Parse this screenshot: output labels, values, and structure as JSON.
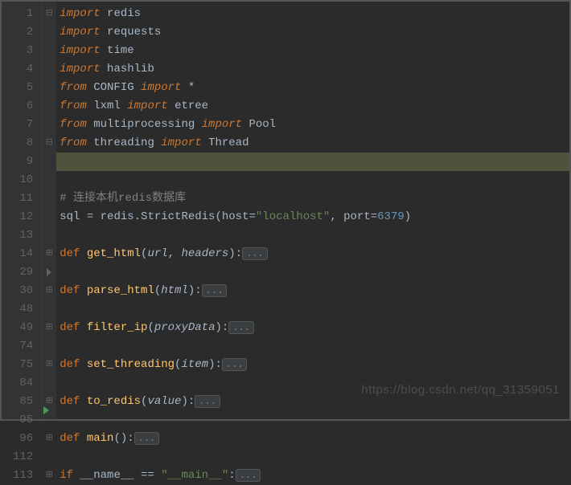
{
  "lines": [
    {
      "num": "1",
      "fold": "⊟",
      "tokens": [
        [
          "kw",
          "import"
        ],
        [
          "ident",
          " redis"
        ]
      ]
    },
    {
      "num": "2",
      "fold": "",
      "tokens": [
        [
          "kw",
          "import"
        ],
        [
          "ident",
          " requests"
        ]
      ]
    },
    {
      "num": "3",
      "fold": "",
      "tokens": [
        [
          "kw",
          "import"
        ],
        [
          "ident",
          " time"
        ]
      ]
    },
    {
      "num": "4",
      "fold": "",
      "tokens": [
        [
          "kw",
          "import"
        ],
        [
          "ident",
          " hashlib"
        ]
      ]
    },
    {
      "num": "5",
      "fold": "",
      "tokens": [
        [
          "kw",
          "from"
        ],
        [
          "ident",
          " CONFIG "
        ],
        [
          "kw",
          "import"
        ],
        [
          "ident",
          " *"
        ]
      ]
    },
    {
      "num": "6",
      "fold": "",
      "tokens": [
        [
          "kw",
          "from"
        ],
        [
          "ident",
          " lxml "
        ],
        [
          "kw",
          "import"
        ],
        [
          "ident",
          " etree"
        ]
      ]
    },
    {
      "num": "7",
      "fold": "",
      "tokens": [
        [
          "kw",
          "from"
        ],
        [
          "ident",
          " multiprocessing "
        ],
        [
          "kw",
          "import"
        ],
        [
          "ident",
          " Pool"
        ]
      ]
    },
    {
      "num": "8",
      "fold": "⊟",
      "tokens": [
        [
          "kw",
          "from"
        ],
        [
          "ident",
          " threading "
        ],
        [
          "kw",
          "import"
        ],
        [
          "ident",
          " Thread"
        ]
      ]
    },
    {
      "num": "9",
      "fold": "",
      "highlight": true,
      "tokens": []
    },
    {
      "num": "10",
      "fold": "",
      "tokens": []
    },
    {
      "num": "11",
      "fold": "",
      "tokens": [
        [
          "comment",
          "# 连接本机redis数据库"
        ]
      ]
    },
    {
      "num": "12",
      "fold": "",
      "tokens": [
        [
          "ident",
          "sql "
        ],
        [
          "op",
          "="
        ],
        [
          "ident",
          " redis.StrictRedis("
        ],
        [
          "ident",
          "host"
        ],
        [
          "op",
          "="
        ],
        [
          "str",
          "\"localhost\""
        ],
        [
          "op",
          ","
        ],
        [
          "ident",
          " port"
        ],
        [
          "op",
          "="
        ],
        [
          "num",
          "6379"
        ],
        [
          "ident",
          ")"
        ]
      ]
    },
    {
      "num": "13",
      "fold": "",
      "tokens": []
    },
    {
      "num": "14",
      "fold": "⊞",
      "tokens": [
        [
          "kw2",
          "def "
        ],
        [
          "fn",
          "get_html"
        ],
        [
          "paren",
          "("
        ],
        [
          "param",
          "url"
        ],
        [
          "op",
          ", "
        ],
        [
          "param",
          "headers"
        ],
        [
          "paren",
          ")"
        ],
        [
          "op",
          ":"
        ],
        [
          "collapsed",
          "..."
        ]
      ]
    },
    {
      "num": "29",
      "fold": "",
      "caret": true,
      "tokens": []
    },
    {
      "num": "30",
      "fold": "⊞",
      "tokens": [
        [
          "kw2",
          "def "
        ],
        [
          "fn",
          "parse_html"
        ],
        [
          "paren",
          "("
        ],
        [
          "param",
          "html"
        ],
        [
          "paren",
          ")"
        ],
        [
          "op",
          ":"
        ],
        [
          "collapsed",
          "..."
        ]
      ]
    },
    {
      "num": "48",
      "fold": "",
      "tokens": []
    },
    {
      "num": "49",
      "fold": "⊞",
      "tokens": [
        [
          "kw2",
          "def "
        ],
        [
          "fn",
          "filter_ip"
        ],
        [
          "paren",
          "("
        ],
        [
          "param",
          "proxyData"
        ],
        [
          "paren",
          ")"
        ],
        [
          "op",
          ":"
        ],
        [
          "collapsed",
          "..."
        ]
      ]
    },
    {
      "num": "74",
      "fold": "",
      "tokens": []
    },
    {
      "num": "75",
      "fold": "⊞",
      "tokens": [
        [
          "kw2",
          "def "
        ],
        [
          "fn",
          "set_threading"
        ],
        [
          "paren",
          "("
        ],
        [
          "param",
          "item"
        ],
        [
          "paren",
          ")"
        ],
        [
          "op",
          ":"
        ],
        [
          "collapsed",
          "..."
        ]
      ]
    },
    {
      "num": "84",
      "fold": "",
      "tokens": []
    },
    {
      "num": "85",
      "fold": "⊞",
      "tokens": [
        [
          "kw2",
          "def "
        ],
        [
          "fn",
          "to_redis"
        ],
        [
          "paren",
          "("
        ],
        [
          "param",
          "value"
        ],
        [
          "paren",
          ")"
        ],
        [
          "op",
          ":"
        ],
        [
          "collapsed",
          "..."
        ]
      ]
    },
    {
      "num": "95",
      "fold": "",
      "tokens": []
    },
    {
      "num": "96",
      "fold": "⊞",
      "tokens": [
        [
          "kw2",
          "def "
        ],
        [
          "fn",
          "main"
        ],
        [
          "paren",
          "()"
        ],
        [
          "op",
          ":"
        ],
        [
          "collapsed",
          "..."
        ]
      ]
    },
    {
      "num": "112",
      "fold": "",
      "tokens": []
    },
    {
      "num": "113",
      "fold": "⊞",
      "run": true,
      "tokens": [
        [
          "kw2",
          "if"
        ],
        [
          "ident",
          " __name__ "
        ],
        [
          "op",
          "=="
        ],
        [
          "ident",
          " "
        ],
        [
          "str",
          "\"__main__\""
        ],
        [
          "op",
          ":"
        ],
        [
          "collapsed",
          "..."
        ]
      ]
    }
  ],
  "watermark": "https://blog.csdn.net/qq_31359051"
}
